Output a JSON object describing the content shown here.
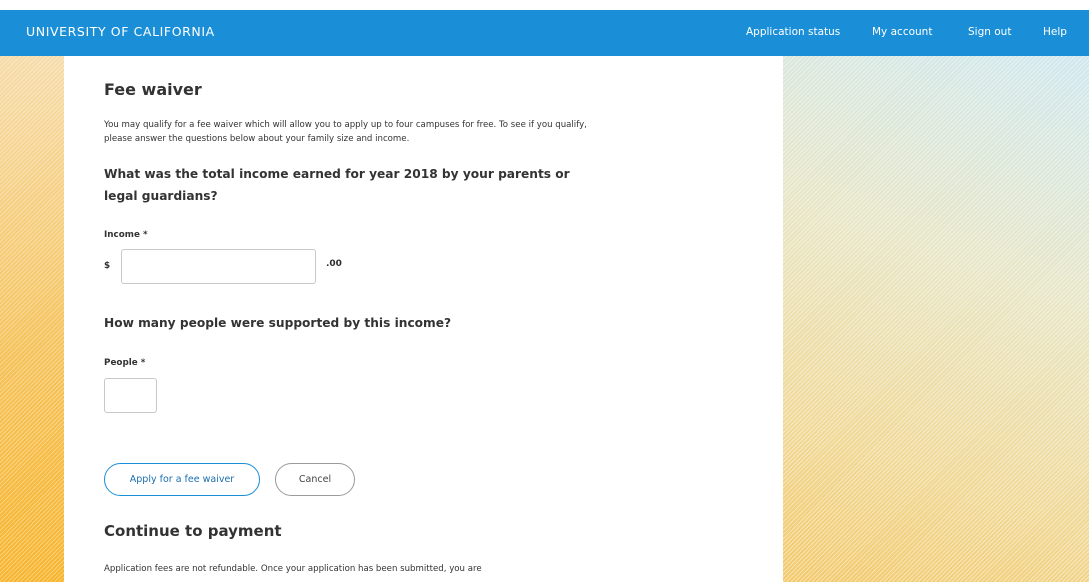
{
  "header": {
    "brand": "UNIVERSITY OF CALIFORNIA",
    "nav": [
      {
        "label": "Application status"
      },
      {
        "label": "My account"
      },
      {
        "label": "Sign out"
      },
      {
        "label": "Help"
      }
    ],
    "bar_color": "#1a8fd8"
  },
  "fee_waiver": {
    "title": "Fee waiver",
    "intro": "You may qualify for a fee waiver which will allow you to apply up to four campuses for free. To see if you qualify, please answer the questions below about your family size and income.",
    "income_question": "What was the total income earned for year 2018 by your parents or legal guardians?",
    "income_label": "Income *",
    "currency_symbol": "$",
    "income_value": "",
    "cents_suffix": ".00",
    "people_question": "How many people were supported by this income?",
    "people_label": "People *",
    "people_value": "",
    "apply_button": "Apply for a fee waiver",
    "cancel_button": "Cancel"
  },
  "payment": {
    "title": "Continue to payment",
    "text": "Application fees are not refundable. Once your application has been submitted, you are"
  }
}
